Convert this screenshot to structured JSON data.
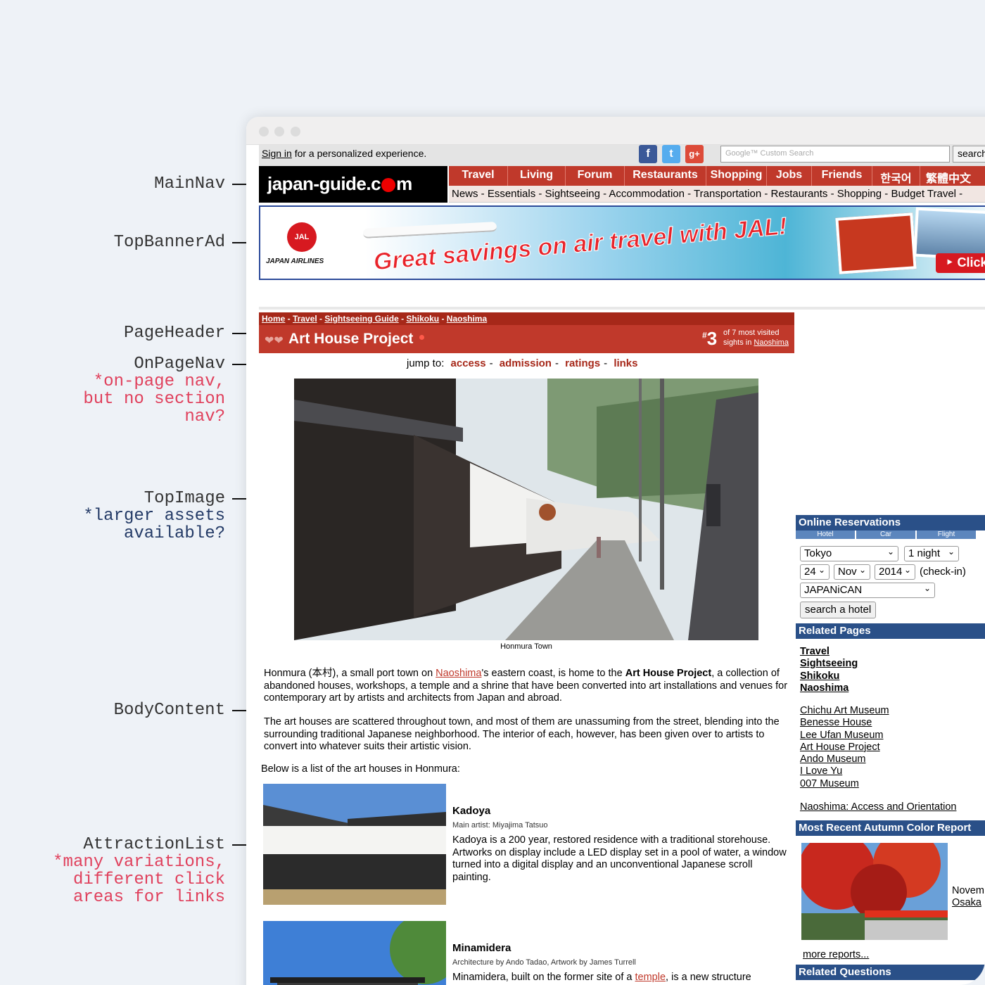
{
  "annotations": [
    {
      "label": "MainNav",
      "notes": []
    },
    {
      "label": "TopBannerAd",
      "notes": []
    },
    {
      "label": "PageHeader",
      "notes": []
    },
    {
      "label": "OnPageNav",
      "notes": [
        "*on-page nav,",
        "but no section",
        "nav?"
      ]
    },
    {
      "label": "TopImage",
      "notes": [
        "*larger assets",
        "available?"
      ]
    },
    {
      "label": "BodyContent",
      "notes": []
    },
    {
      "label": "AttractionList",
      "notes": [
        "*many variations,",
        "different click",
        "areas for links"
      ]
    }
  ],
  "topbar": {
    "signin_link": "Sign in",
    "signin_text": " for a personalized experience.",
    "search_placeholder": "Google™ Custom Search",
    "search_button": "search"
  },
  "logo": {
    "pre": "japan-guide.c",
    "post": "m"
  },
  "main_nav": [
    "Travel",
    "Living",
    "Forum",
    "Restaurants",
    "Shopping",
    "Jobs",
    "Friends",
    "한국어",
    "繁體中文"
  ],
  "sub_nav": "News - Essentials - Sightseeing - Accommodation - Transportation - Restaurants - Shopping - Budget Travel -",
  "banner": {
    "logo_text": "JAL",
    "airline": "JAPAN AIRLINES",
    "headline": "Great savings on air travel with JAL!",
    "cta": "‣ Click"
  },
  "breadcrumb": [
    "Home",
    "Travel",
    "Sightseeing Guide",
    "Shikoku",
    "Naoshima"
  ],
  "header": {
    "title": "Art House Project",
    "rank": "3",
    "rank_sign": "#",
    "rank_line1": "of 7 most visited",
    "rank_line2": "sights in ",
    "rank_link": "Naoshima"
  },
  "jump": {
    "label": "jump to:",
    "links": [
      "access",
      "admission",
      "ratings",
      "links"
    ]
  },
  "top_image": {
    "caption": "Honmura Town"
  },
  "body": {
    "p1": {
      "a": "Honmura (本村), a small port town on ",
      "link": "Naoshima",
      "b": "'s eastern coast, is home to the ",
      "bold": "Art House Project",
      "c": ", a collection of abandoned houses, workshops, a temple and a shrine that have been converted into art installations and venues for contemporary art by artists and architects from Japan and abroad."
    },
    "p2": "The art houses are scattered throughout town, and most of them are unassuming from the street, blending into the surrounding traditional Japanese neighborhood. The interior of each, however, has been given over to artists to convert into whatever suits their artistic vision.",
    "p3": "Below is a list of the art houses in Honmura:"
  },
  "attractions": [
    {
      "title": "Kadoya",
      "artist": "Main artist: Miyajima Tatsuo",
      "desc": "Kadoya is a 200 year, restored residence with a traditional storehouse. Artworks on display include a LED display set in a pool of water, a window turned into a digital display and an unconventional Japanese scroll painting."
    },
    {
      "title": "Minamidera",
      "artist": "Architecture by Ando Tadao, Artwork by James Turrell",
      "desc_a": "Minamidera, built on the former site of a ",
      "desc_link": "temple",
      "desc_b": ", is a new structure"
    }
  ],
  "sidebar": {
    "reservations": {
      "title": "Online Reservations",
      "tabs": [
        "Hotel",
        "Car",
        "Flight"
      ],
      "city": "Tokyo",
      "nights": "1 night",
      "day": "24",
      "month": "Nov",
      "year": "2014",
      "checkin": "(check-in)",
      "provider": "JAPANiCAN",
      "button": "search a hotel"
    },
    "related_title": "Related Pages",
    "related_bold": [
      "Travel",
      "Sightseeing",
      "Shikoku",
      "Naoshima"
    ],
    "related": [
      "Chichu Art Museum",
      "Benesse House",
      "Lee Ufan Museum",
      "Art House Project",
      "Ando Museum",
      "I Love Yu",
      "007 Museum"
    ],
    "access_link": "Naoshima: Access and Orientation",
    "autumn_title": "Most Recent Autumn Color Report",
    "autumn_date": "Novem",
    "autumn_place": "Osaka",
    "more_reports": "more reports...",
    "questions_title": "Related Questions"
  },
  "colors": {
    "nav_red": "#c0392b",
    "sidebar_blue": "#2a5088",
    "note_pink": "#e0405c"
  }
}
